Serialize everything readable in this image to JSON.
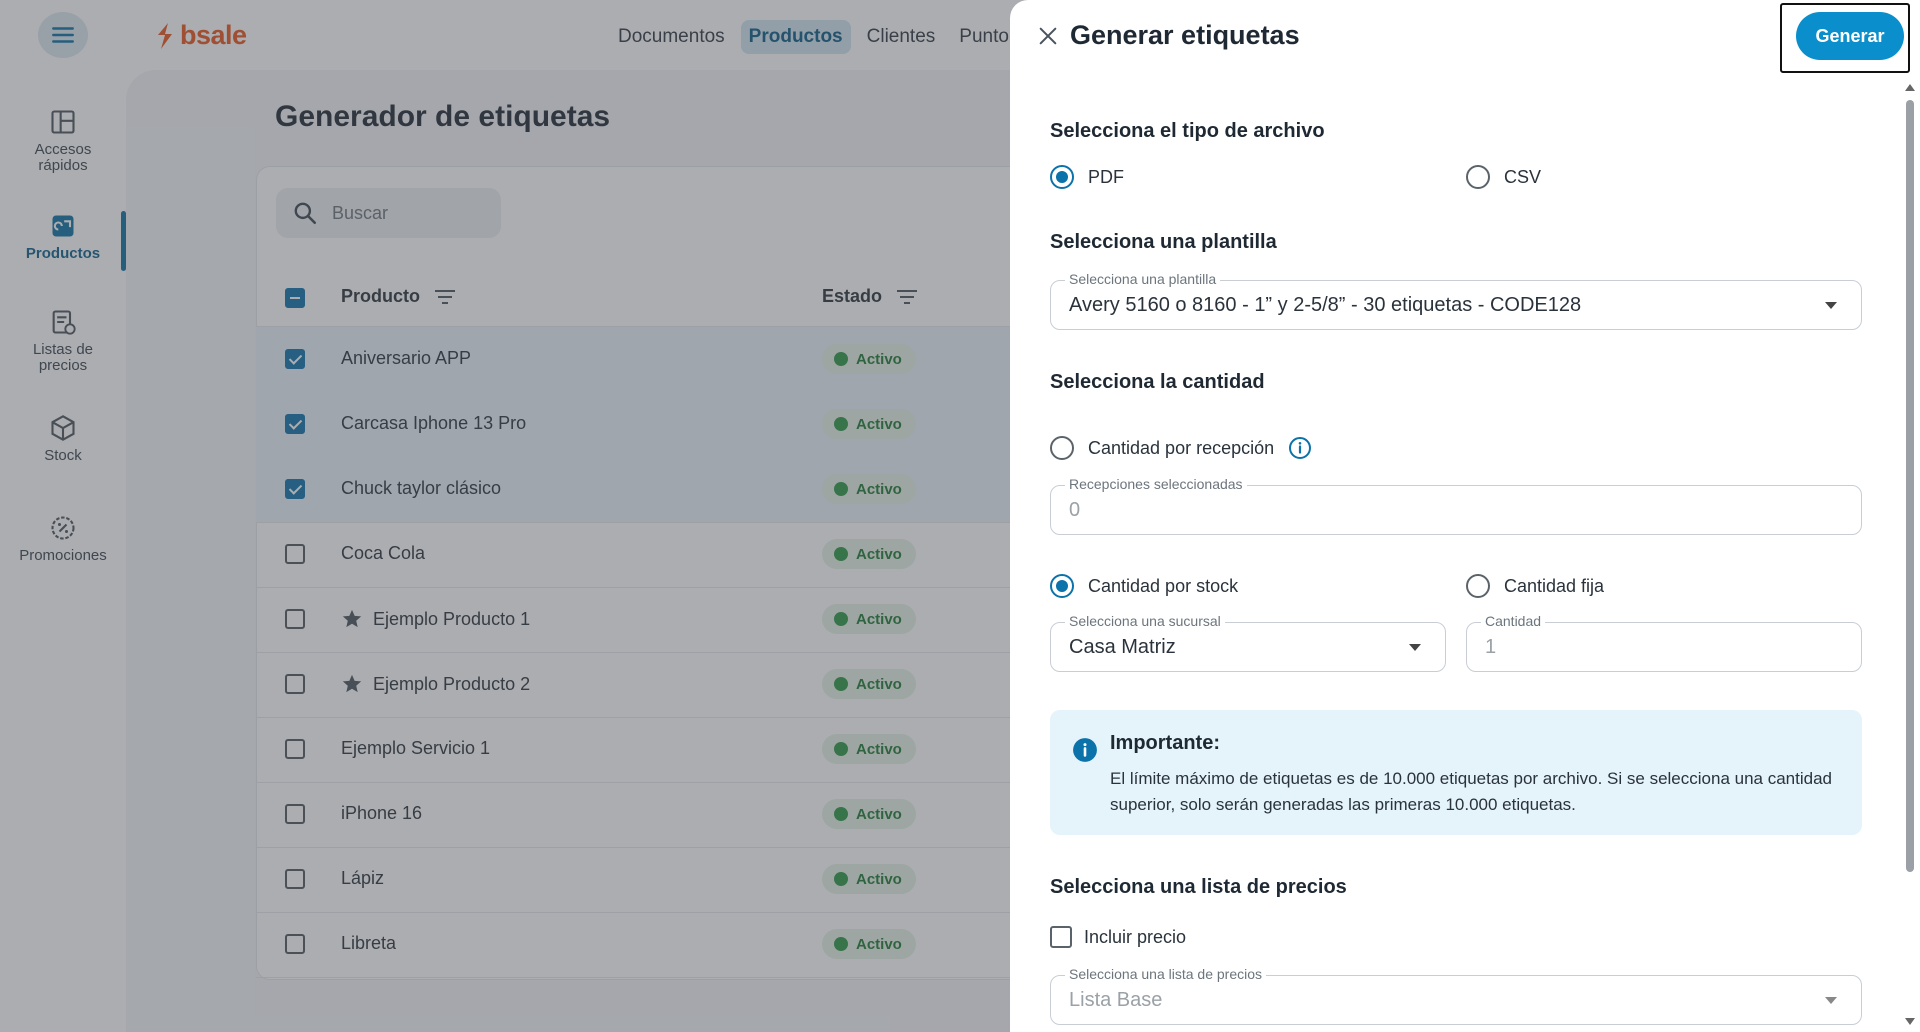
{
  "topbar": {
    "logo": "bsale",
    "nav": [
      "Documentos",
      "Productos",
      "Clientes",
      "Punto d"
    ],
    "active_nav": "Productos"
  },
  "sidebar": {
    "items": [
      {
        "label": "Accesos rápidos",
        "icon": "dashboard-icon"
      },
      {
        "label": "Productos",
        "icon": "products-icon",
        "active": true
      },
      {
        "label": "Listas de precios",
        "icon": "price-list-icon"
      },
      {
        "label": "Stock",
        "icon": "box-icon"
      },
      {
        "label": "Promociones",
        "icon": "discount-badge-icon"
      }
    ]
  },
  "page": {
    "title": "Generador de etiquetas",
    "search_placeholder": "Buscar",
    "columns": [
      "Producto",
      "Estado"
    ],
    "rows": [
      {
        "name": "Aniversario APP",
        "status": "Activo",
        "checked": true,
        "star": false
      },
      {
        "name": "Carcasa Iphone 13 Pro",
        "status": "Activo",
        "checked": true,
        "star": false
      },
      {
        "name": "Chuck taylor clásico",
        "status": "Activo",
        "checked": true,
        "star": false
      },
      {
        "name": "Coca Cola",
        "status": "Activo",
        "checked": false,
        "star": false
      },
      {
        "name": "Ejemplo Producto 1",
        "status": "Activo",
        "checked": false,
        "star": true
      },
      {
        "name": "Ejemplo Producto 2",
        "status": "Activo",
        "checked": false,
        "star": true
      },
      {
        "name": "Ejemplo Servicio 1",
        "status": "Activo",
        "checked": false,
        "star": false
      },
      {
        "name": "iPhone 16",
        "status": "Activo",
        "checked": false,
        "star": false
      },
      {
        "name": "Lápiz",
        "status": "Activo",
        "checked": false,
        "star": false
      },
      {
        "name": "Libreta",
        "status": "Activo",
        "checked": false,
        "star": false
      }
    ]
  },
  "drawer": {
    "title": "Generar etiquetas",
    "generate_label": "Generar",
    "file_type": {
      "heading": "Selecciona el tipo de archivo",
      "options": [
        "PDF",
        "CSV"
      ],
      "selected": "PDF"
    },
    "template": {
      "heading": "Selecciona una plantilla",
      "field_label": "Selecciona una plantilla",
      "value": "Avery 5160 o 8160 - 1” y 2-5/8” - 30 etiquetas - CODE128"
    },
    "quantity": {
      "heading": "Selecciona la cantidad",
      "by_reception_label": "Cantidad por recepción",
      "receptions_field_label": "Recepciones seleccionadas",
      "receptions_value": "0",
      "by_stock_label": "Cantidad por stock",
      "fixed_label": "Cantidad fija",
      "selected": "Cantidad por stock",
      "branch_field_label": "Selecciona una sucursal",
      "branch_value": "Casa Matriz",
      "amount_field_label": "Cantidad",
      "amount_value": "1"
    },
    "notice": {
      "title": "Importante:",
      "body": "El límite máximo de etiquetas es de 10.000 etiquetas por archivo. Si se selecciona una cantidad superior, solo serán generadas las primeras 10.000 etiquetas."
    },
    "price_list": {
      "heading": "Selecciona una lista de precios",
      "include_label": "Incluir precio",
      "include_checked": false,
      "field_label": "Selecciona una lista de precios",
      "value": "Lista Base"
    }
  },
  "colors": {
    "primary": "#0a8fcc",
    "brand": "#e8561e",
    "active_green": "#2d9846",
    "notice_bg": "#e5f3fa"
  }
}
